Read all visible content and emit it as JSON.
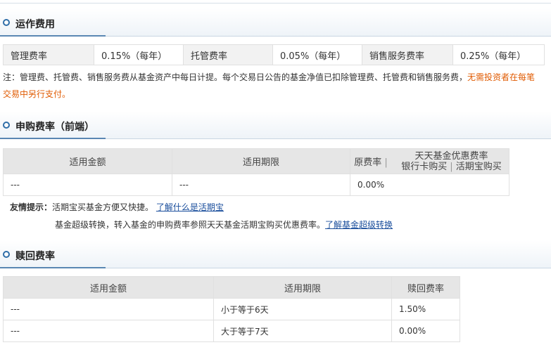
{
  "section1": {
    "title": "运作费用",
    "fees": [
      {
        "label": "管理费率",
        "value": "0.15%（每年）"
      },
      {
        "label": "托管费率",
        "value": "0.05%（每年）"
      },
      {
        "label": "销售服务费率",
        "value": "0.25%（每年）"
      }
    ],
    "note_prefix": "注：",
    "note_main": "管理费、托管费、销售服务费从基金资产中每日计提。每个交易日公告的基金净值已扣除管理费、托管费和销售服务费，",
    "note_orange_line1": "无需投资者在每笔",
    "note_orange_line2": "交易中另行支付。"
  },
  "section2": {
    "title": "申购费率（前端）",
    "headers": {
      "amount": "适用金额",
      "period": "适用期限",
      "original": "原费率",
      "tiantian": "天天基金优惠费率",
      "bank_card": "银行卡购买",
      "huoqibao": "活期宝购买"
    },
    "rows": [
      {
        "amount": "---",
        "period": "---",
        "original": "0.00%"
      }
    ],
    "hint_label": "友情提示：",
    "hint_line1": "活期宝买基金方便又快捷。",
    "hint_link1": "了解什么是活期宝",
    "hint_line2": "基金超级转换，转入基金的申购费率参照天天基金活期宝购买优惠费率。",
    "hint_link2": "了解基金超级转换"
  },
  "section3": {
    "title": "赎回费率",
    "headers": {
      "amount": "适用金额",
      "period": "适用期限",
      "rate": "赎回费率"
    },
    "rows": [
      {
        "amount": "---",
        "period": "小于等于6天",
        "rate": "1.50%"
      },
      {
        "amount": "---",
        "period": "大于等于7天",
        "rate": "0.00%"
      }
    ]
  }
}
